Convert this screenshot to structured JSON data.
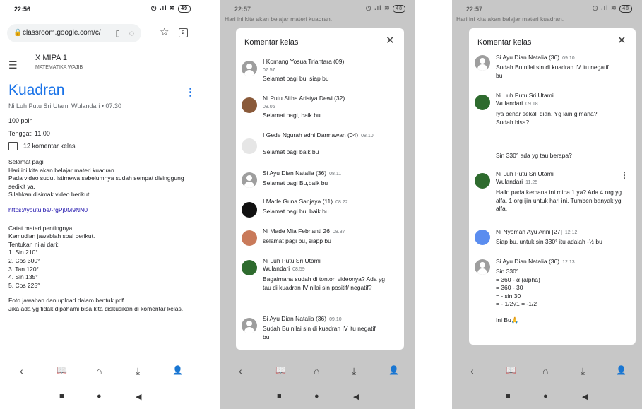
{
  "phone1": {
    "status_time": "22:56",
    "status_icons": "◷ .ıl ≋",
    "battery": "49",
    "url": "classroom.google.com/c/",
    "tab_count": "2",
    "class_name": "X MIPA 1",
    "class_subject": "MATEMATIKA WAJIB",
    "title": "Kuadran",
    "meta": "Ni Luh Putu Sri Utami Wulandari • 07.30",
    "points": "100 poin",
    "due": "Tenggat: 11.00",
    "comment_count": "12 komentar kelas",
    "body": [
      "Selamat pagi",
      "Hari ini kita akan belajar materi kuadran.",
      "Pada video sudut istimewa sebelumnya sudah sempat disinggung sedikit ya.",
      "Silahkan disimak video berikut"
    ],
    "video_link": "https://youtu.be/-rgPj0M9NN0",
    "body2": [
      "Catat materi pentingnya.",
      "Kemudian jawablah soal berikut.",
      "Tentukan nilai dari:",
      "1. Sin 210°",
      "2. Cos 300°",
      "3. Tan 120°",
      "4. Sin 135°",
      "5. Cos 225°"
    ],
    "body3": [
      "Foto jawaban dan upload dalam bentuk pdf.",
      "Jika ada yg tidak dipahami bisa kita diskusikan di komentar kelas."
    ]
  },
  "phone2": {
    "status_time": "22:57",
    "battery": "48",
    "behind_line": "Hari ini kita akan belajar materi kuadran.",
    "card_title": "Komentar kelas",
    "comments": [
      {
        "name": "I Komang Yosua Triantara (09)",
        "time": "07.57",
        "text": "Selamat pagi bu, siap bu"
      },
      {
        "name": "Ni Putu Sitha Aristya Dewi (32)",
        "time": "08.06",
        "text": "Selamat pagi,  baik bu"
      },
      {
        "name": "I Gede Ngurah adhi Darmawan (04)",
        "time": "08.10",
        "text": "Selamat pagi baik bu"
      },
      {
        "name": "Si Ayu Dian Natalia (36)",
        "time": "08.11",
        "text": "Selamat pagi Bu,baik bu"
      },
      {
        "name": "I Made Guna Sanjaya (11)",
        "time": "08.22",
        "text": "Selamat pagi bu, baik bu"
      },
      {
        "name": "Ni Made Mia Febrianti 26",
        "time": "08.37",
        "text": "selamat pagi bu, siapp bu"
      },
      {
        "name": "Ni Luh Putu Sri Utami Wulandari",
        "time": "08.59",
        "text": "Bagaimana sudah di tonton videonya? Ada yg tau di kuadran IV nilai sin positif/ negatif?"
      },
      {
        "name": "Si Ayu Dian Natalia (36)",
        "time": "09.10",
        "text": "Sudah Bu,nilai sin di kuadran IV itu negatif bu"
      }
    ]
  },
  "phone3": {
    "status_time": "22:57",
    "battery": "48",
    "behind_line": "Hari ini kita akan belajar materi kuadran.",
    "card_title": "Komentar kelas",
    "comments": [
      {
        "name": "Si Ayu Dian Natalia (36)",
        "time": "09.10",
        "text": "Sudah Bu,nilai sin di kuadran IV itu negatif bu"
      },
      {
        "name": "Ni Luh Putu Sri Utami Wulandari",
        "time": "09.18",
        "text": "Iya benar sekali dian. Yg lain gimana? Sudah bisa?"
      },
      {
        "name": "",
        "time": "",
        "text": "Sin 330° ada yg tau berapa?"
      },
      {
        "name": "Ni Luh Putu Sri Utami Wulandari",
        "time": "11.25",
        "text": "Hallo pada kemana ini mipa 1 ya? Ada 4 org yg alfa, 1 org ijin untuk hari ini. Tumben banyak yg alfa."
      },
      {
        "name": "Ni Nyoman Ayu Arini [27]",
        "time": "12.12",
        "text": "Siap bu, untuk sin 330° itu adalah -½ bu"
      },
      {
        "name": "Si Ayu Dian Natalia (36)",
        "time": "12.13",
        "text": "Sin 330°\n= 360 - α (alpha)\n= 360 - 30\n= - sin 30\n= - 1/2√1 = -1/2\n\nIni Bu🙏"
      }
    ]
  },
  "icons": {
    "back": "‹",
    "book": "📖",
    "home": "⌂",
    "download": "⤓",
    "user": "👤",
    "stop": "■",
    "circle": "●",
    "triangle": "◀"
  }
}
